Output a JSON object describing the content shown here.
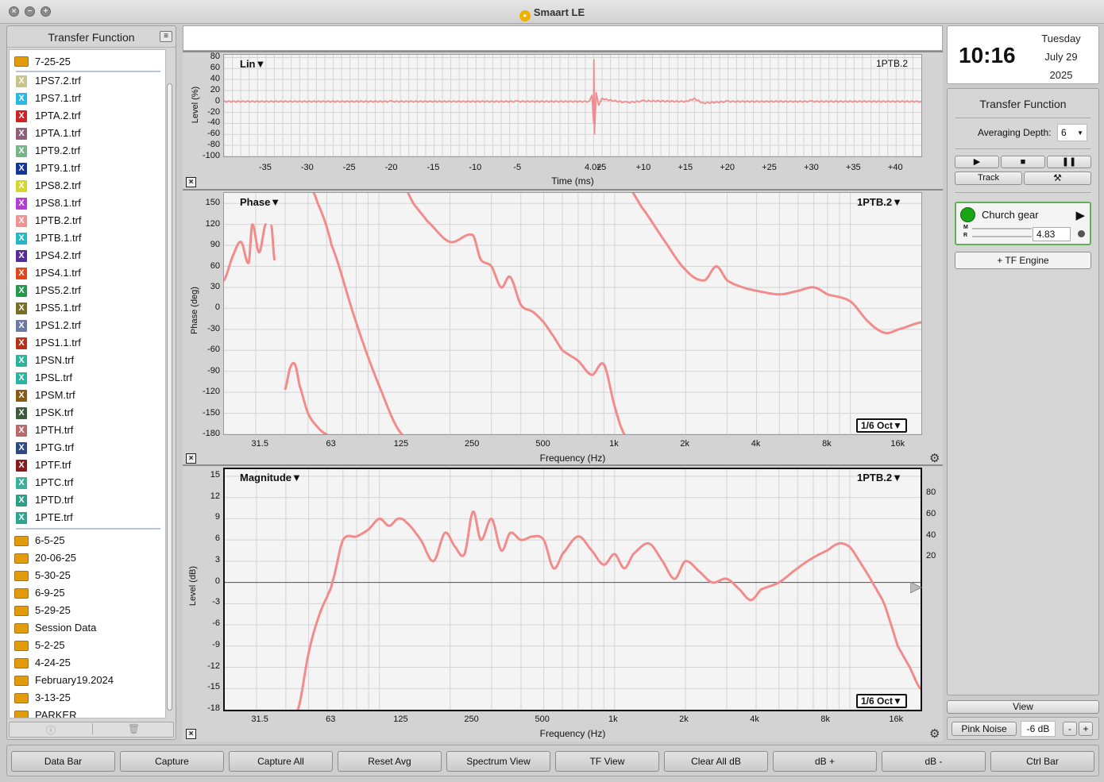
{
  "window": {
    "title": "Smaart LE"
  },
  "sidebar": {
    "header": "Transfer Function",
    "current_folder": "7-25-25",
    "files": [
      {
        "name": "1PS7.2.trf",
        "color": "#c9c48a"
      },
      {
        "name": "1PS7.1.trf",
        "color": "#27b7e8"
      },
      {
        "name": "1PTA.2.trf",
        "color": "#d42020"
      },
      {
        "name": "1PTA.1.trf",
        "color": "#8e5e7a"
      },
      {
        "name": "1PT9.2.trf",
        "color": "#74b58a"
      },
      {
        "name": "1PT9.1.trf",
        "color": "#13359c"
      },
      {
        "name": "1PS8.2.trf",
        "color": "#d6d62a"
      },
      {
        "name": "1PS8.1.trf",
        "color": "#b73ad8"
      },
      {
        "name": "1PTB.2.trf",
        "color": "#f49090"
      },
      {
        "name": "1PTB.1.trf",
        "color": "#23b8c8"
      },
      {
        "name": "1PS4.2.trf",
        "color": "#5a2a9a"
      },
      {
        "name": "1PS4.1.trf",
        "color": "#e44516"
      },
      {
        "name": "1PS5.2.trf",
        "color": "#1f9b4c"
      },
      {
        "name": "1PS5.1.trf",
        "color": "#777020"
      },
      {
        "name": "1PS1.2.trf",
        "color": "#6a7aa8"
      },
      {
        "name": "1PS1.1.trf",
        "color": "#b8321a"
      },
      {
        "name": "1PSN.trf",
        "color": "#2cb49a"
      },
      {
        "name": "1PSL.trf",
        "color": "#27b5a5"
      },
      {
        "name": "1PSM.trf",
        "color": "#8a5a14"
      },
      {
        "name": "1PSK.trf",
        "color": "#3c5a3c"
      },
      {
        "name": "1PTH.trf",
        "color": "#b86a6a"
      },
      {
        "name": "1PTG.trf",
        "color": "#2c4a8a"
      },
      {
        "name": "1PTF.trf",
        "color": "#8a1a1a"
      },
      {
        "name": "1PTC.trf",
        "color": "#38b09a"
      },
      {
        "name": "1PTD.trf",
        "color": "#2aa088"
      },
      {
        "name": "1PTE.trf",
        "color": "#28a890"
      }
    ],
    "folders": [
      "6-5-25",
      "20-06-25",
      "5-30-25",
      "6-9-25",
      "5-29-25",
      "Session Data",
      "5-2-25",
      "4-24-25",
      "February19.2024",
      "3-13-25",
      "PARKER"
    ]
  },
  "clock": {
    "time": "10:16",
    "weekday": "Tuesday",
    "monthday": "July 29",
    "year": "2025"
  },
  "control": {
    "title": "Transfer Function",
    "averaging_label": "Averaging Depth:",
    "averaging_value": "6",
    "track_label": "Track",
    "engine_name": "Church gear",
    "m_label": "M",
    "r_label": "R",
    "delay_value": "4.83",
    "add_engine_label": "+ TF Engine",
    "view_label": "View",
    "pink_noise_label": "Pink Noise",
    "pink_noise_level": "-6 dB",
    "minus_label": "-",
    "plus_label": "+"
  },
  "bottom_bar": [
    "Data Bar",
    "Capture",
    "Capture All",
    "Reset Avg",
    "Spectrum View",
    "TF View",
    "Clear All dB",
    "dB +",
    "dB -",
    "Ctrl Bar"
  ],
  "graphs": {
    "trace_color": "#f28c8c",
    "impulse": {
      "name": "Lin▼",
      "trace": "1PTB.2",
      "ylabel": "Level (%)",
      "xlabel": "Time (ms)",
      "yticks": [
        "80",
        "60",
        "40",
        "20",
        "0",
        "-20",
        "-40",
        "-60",
        "-80",
        "-100"
      ],
      "xticks": [
        "-35",
        "-30",
        "-25",
        "-20",
        "-15",
        "-10",
        "-5",
        "4.02",
        "+5",
        "+10",
        "+15",
        "+20",
        "+25",
        "+30",
        "+35",
        "+40"
      ]
    },
    "phase": {
      "name": "Phase▼",
      "trace": "1PTB.2▼",
      "ylabel": "Phase (deg)",
      "xlabel": "Frequency (Hz)",
      "smoothing": "1/6 Oct▼",
      "yticks": [
        "150",
        "120",
        "90",
        "60",
        "30",
        "0",
        "-30",
        "-60",
        "-90",
        "-120",
        "-150",
        "-180"
      ],
      "xticks": [
        "31.5",
        "63",
        "125",
        "250",
        "500",
        "1k",
        "2k",
        "4k",
        "8k",
        "16k"
      ]
    },
    "magnitude": {
      "name": "Magnitude▼",
      "trace": "1PTB.2▼",
      "ylabel": "Level (dB)",
      "xlabel": "Frequency (Hz)",
      "smoothing": "1/6 Oct▼",
      "yticks": [
        "15",
        "12",
        "9",
        "6",
        "3",
        "0",
        "-3",
        "-6",
        "-9",
        "-12",
        "-15",
        "-18"
      ],
      "y2ticks": [
        "80",
        "60",
        "40",
        "20"
      ],
      "xticks": [
        "31.5",
        "63",
        "125",
        "250",
        "500",
        "1k",
        "2k",
        "4k",
        "8k",
        "16k"
      ]
    }
  },
  "chart_data": [
    {
      "type": "line",
      "title": "Lin",
      "xlabel": "Time (ms)",
      "ylabel": "Level (%)",
      "xlim": [
        -40,
        43
      ],
      "ylim": [
        -100,
        85
      ],
      "series": [
        {
          "name": "1PTB.2",
          "x": [
            -40,
            -20,
            -5,
            3.5,
            3.8,
            4.0,
            4.02,
            4.1,
            4.3,
            4.6,
            5,
            6,
            8,
            10,
            15,
            16,
            17,
            20,
            30,
            43
          ],
          "y": [
            0,
            0,
            0,
            0,
            10,
            -40,
            75,
            -60,
            15,
            -8,
            5,
            2,
            -2,
            1,
            0,
            5,
            -3,
            0,
            0,
            0
          ]
        }
      ]
    },
    {
      "type": "line",
      "title": "Phase",
      "xlabel": "Frequency (Hz)",
      "ylabel": "Phase (deg)",
      "xscale": "log",
      "xlim": [
        22,
        20000
      ],
      "ylim": [
        -180,
        165
      ],
      "series": [
        {
          "name": "1PTB.2",
          "segments": [
            {
              "x": [
                22,
                24,
                26,
                28,
                29,
                31,
                33
              ],
              "y": [
                40,
                75,
                95,
                65,
                120,
                80,
                120
              ]
            },
            {
              "x": [
                35,
                36
              ],
              "y": [
                118,
                70
              ]
            },
            {
              "x": [
                40,
                42,
                44,
                46,
                50,
                55,
                60
              ],
              "y": [
                -115,
                -85,
                -80,
                -110,
                -150,
                -170,
                -180
              ]
            },
            {
              "x": [
                50,
                55,
                63,
                80,
                100,
                125
              ],
              "y": [
                178,
                150,
                90,
                -20,
                -110,
                -180
              ]
            },
            {
              "x": [
                125,
                140,
                160,
                200,
                250,
                270,
                300,
                330,
                360,
                400,
                450,
                500,
                550,
                600,
                700,
                800,
                900,
                1000,
                1100
              ],
              "y": [
                180,
                150,
                125,
                95,
                105,
                70,
                60,
                30,
                45,
                5,
                -5,
                -20,
                -40,
                -60,
                -75,
                -95,
                -80,
                -140,
                -180
              ]
            },
            {
              "x": [
                1100,
                1300,
                1600,
                2000,
                2400,
                2700,
                3000,
                3500,
                4000,
                5000,
                6000,
                7000,
                8000,
                10000,
                12000,
                14000,
                16000,
                20000
              ],
              "y": [
                180,
                145,
                100,
                55,
                40,
                60,
                40,
                30,
                25,
                20,
                25,
                30,
                20,
                10,
                -20,
                -35,
                -30,
                -20
              ]
            }
          ]
        }
      ]
    },
    {
      "type": "line",
      "title": "Magnitude",
      "xlabel": "Frequency (Hz)",
      "ylabel": "Level (dB)",
      "xscale": "log",
      "xlim": [
        22,
        20000
      ],
      "ylim": [
        -18,
        16
      ],
      "series": [
        {
          "name": "1PTB.2",
          "x": [
            45,
            50,
            55,
            60,
            63,
            70,
            80,
            90,
            100,
            110,
            120,
            130,
            150,
            170,
            190,
            210,
            230,
            250,
            270,
            300,
            330,
            360,
            400,
            450,
            500,
            550,
            600,
            700,
            800,
            900,
            1000,
            1100,
            1200,
            1400,
            1600,
            1800,
            2000,
            2300,
            2600,
            3000,
            3400,
            3800,
            4200,
            5000,
            6000,
            7000,
            8000,
            9000,
            10000,
            11000,
            12000,
            13000,
            14000,
            15000,
            16000,
            18000,
            20000
          ],
          "y": [
            -18,
            -10,
            -5,
            -2,
            0,
            6,
            6.5,
            7.5,
            9,
            8,
            9,
            8.5,
            6,
            3,
            7,
            5,
            4,
            10,
            6,
            9,
            4.5,
            7,
            6,
            6.5,
            6,
            2,
            4,
            6.5,
            4.5,
            2.5,
            4,
            2,
            4,
            5.5,
            3,
            0.5,
            3,
            1.5,
            0,
            0.5,
            -1,
            -2.5,
            -1,
            0,
            2,
            3.5,
            4.5,
            5.5,
            5,
            3,
            1,
            -1,
            -3,
            -6,
            -9,
            -12,
            -15
          ]
        }
      ]
    }
  ]
}
